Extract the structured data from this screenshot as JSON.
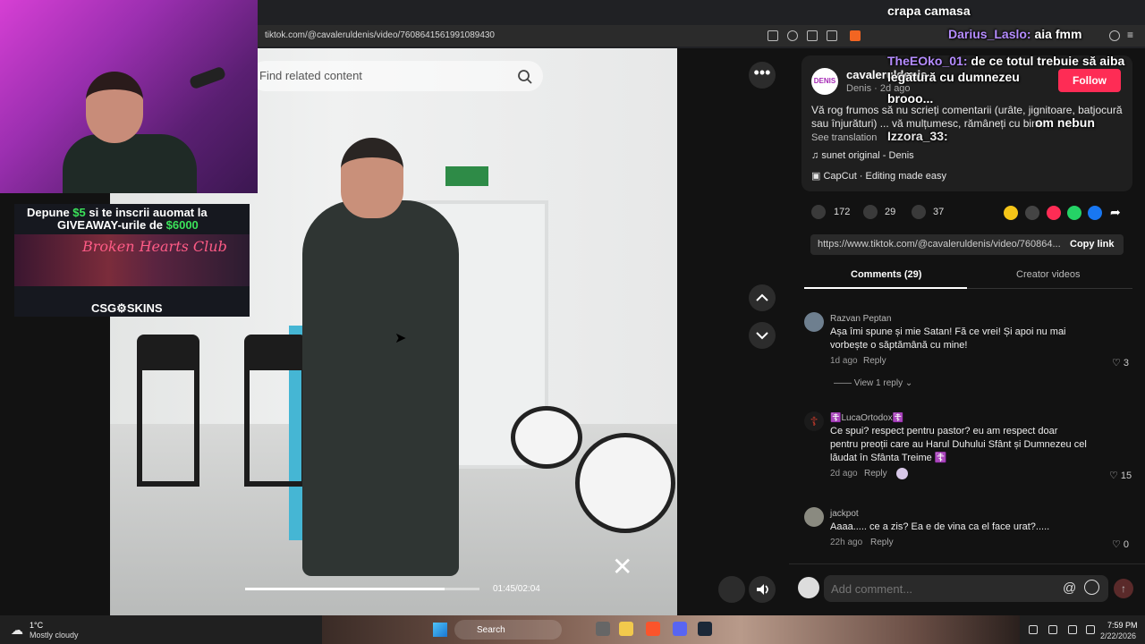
{
  "browser": {
    "url": "tiktok.com/@cavaleruldenis/video/7608641561991089430"
  },
  "video": {
    "search_placeholder": "Find related content",
    "timecode": "01:45/02:04",
    "progress": 0.85
  },
  "post": {
    "author_name": "cavaleruldenis",
    "author_sub": "Denis · 2d ago",
    "avatar_text": "DENIS",
    "follow_label": "Follow",
    "description": "Vă rog frumos să nu scrieți comentarii (urâte, jignitoare, batjocură sau înjurături) ... vă mulțumesc, rămâneți cu bine",
    "see_translation": "See translation",
    "sound": "sunet original - Denis",
    "capcut": "CapCut · Editing made easy",
    "likes": "172",
    "comments": "29",
    "saves": "37",
    "link": "https://www.tiktok.com/@cavaleruldenis/video/760864...",
    "copy_link": "Copy link"
  },
  "tabs": {
    "comments": "Comments (29)",
    "creator": "Creator videos"
  },
  "comments": [
    {
      "user": "Razvan Peptan",
      "text1": "Așa îmi spune și mie Satan! Fă ce vrei! Și apoi nu mai",
      "text2": "vorbește o săptămână cu mine!",
      "text3": "",
      "time": "1d ago",
      "reply": "Reply",
      "likes": "3"
    },
    {
      "user": "☦️LucaOrtodox☦️",
      "text1": "Ce spui? respect pentru pastor? eu am respect doar",
      "text2": "pentru preoții care au Harul Duhului Sfânt și Dumnezeu cel",
      "text3": "lăudat în Sfânta Treime ☦️",
      "time": "2d ago",
      "reply": "Reply",
      "likes": "15"
    },
    {
      "user": "jackpot",
      "text1": "Aaaa..... ce a zis? Ea e de vina ca el face urat?.....",
      "text2": "",
      "text3": "",
      "time": "22h ago",
      "reply": "Reply",
      "likes": "0"
    }
  ],
  "view_reply": "—— View 1 reply ⌄",
  "comment_input_placeholder": "Add comment...",
  "promo": {
    "line1_a": "Depune ",
    "line1_b": "$5",
    "line1_c": " si te inscrii auomat la",
    "line2_a": "GIVEAWAY-urile de ",
    "line2_b": "$6000",
    "title": "Broken Hearts Club",
    "brand": "CSG⚙SKINS"
  },
  "chat": {
    "top": "crapa camasa",
    "m1_user": "Darius_Laslo:",
    "m1_text": "aia fmm",
    "m2_user": "TheEOko_01:",
    "m2_text": "de ce totul trebuie să aiba legătură cu dumnezeu",
    "m3_text": "brooo...",
    "m4_text": "om nebun",
    "m5_user": "Izzora_33:"
  },
  "taskbar": {
    "temp": "1°C",
    "weather": "Mostly cloudy",
    "search": "Search",
    "time": "7:59 PM",
    "date": "2/22/2026"
  },
  "colors": {
    "accent": "#fe2c55",
    "panel_bg": "#121212",
    "chat_user": "#b58cff",
    "promo_green": "#3be25a"
  }
}
